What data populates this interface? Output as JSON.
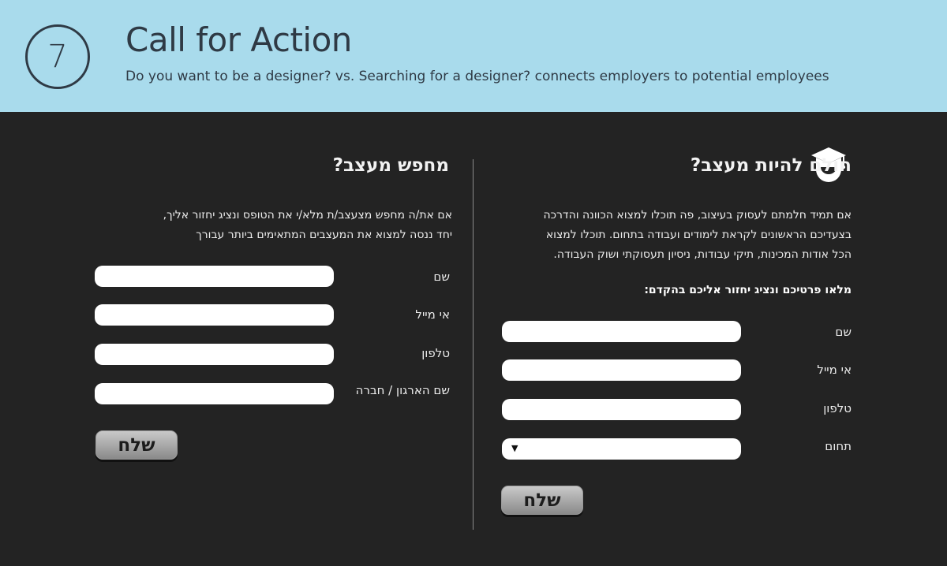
{
  "header": {
    "step_number": "7",
    "title": "Call for Action",
    "subtitle": "Do you want to be a designer? vs. Searching for a designer? connects employers to potential employees"
  },
  "designer_column": {
    "title": "חולם להיות מעצב?",
    "icon": "graduation-cap-icon",
    "description_lines": [
      "אם תמיד חלמתם לעסוק בעיצוב, פה תוכלו למצוא הכוונה והדרכה",
      "בצעדיכם הראשונים לקראת לימודים ועבודה בתחום. תוכלו למצוא",
      "הכל אודות המכינות, תיקי עבודות, ניסיון תעסוקתי ושוק העבודה."
    ],
    "form_heading": "מלאו פרטיכם ונציג יחזור אליכם בהקדם:",
    "fields": {
      "name_label": "שם",
      "name_value": "",
      "email_label": "אי מייל",
      "email_value": "",
      "phone_label": "טלפון",
      "phone_value": "",
      "field_label": "תחום",
      "field_selected": ""
    },
    "send_label": "שלח"
  },
  "employer_column": {
    "title": "מחפש מעצב?",
    "description_lines": [
      "אם את/ה מחפש מצעצב/ת מלא/י את הטופס ונציג יחזור אליך,",
      "יחד ננסה למצוא את המעצבים המתאימים ביותר עבורך"
    ],
    "fields": {
      "name_label": "שם",
      "name_value": "",
      "email_label": "אי מייל",
      "email_value": "",
      "phone_label": "טלפון",
      "phone_value": "",
      "company_label": "שם הארגון / חברה",
      "company_value": ""
    },
    "send_label": "שלח"
  },
  "colors": {
    "header_bg": "#a9dbec",
    "body_bg": "#232323",
    "header_text": "#2f3a45"
  }
}
